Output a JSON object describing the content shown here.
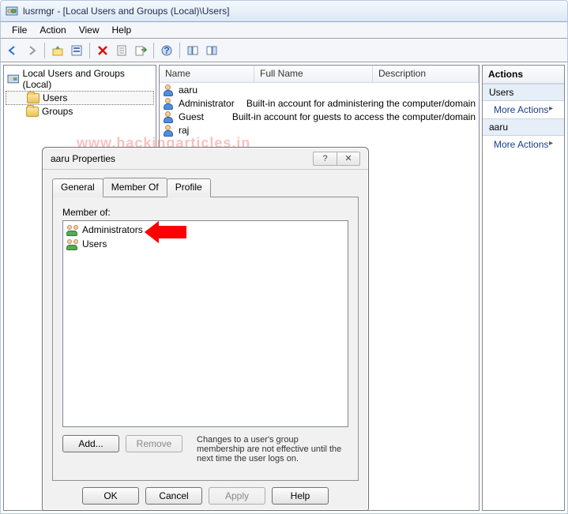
{
  "window": {
    "title": "lusrmgr - [Local Users and Groups (Local)\\Users]"
  },
  "menu": {
    "file": "File",
    "action": "Action",
    "view": "View",
    "help": "Help"
  },
  "tree": {
    "root": "Local Users and Groups (Local)",
    "users": "Users",
    "groups": "Groups"
  },
  "list": {
    "headers": {
      "name": "Name",
      "fullname": "Full Name",
      "description": "Description"
    },
    "rows": [
      {
        "name": "aaru",
        "fullname": "",
        "description": ""
      },
      {
        "name": "Administrator",
        "fullname": "",
        "description": "Built-in account for administering the computer/domain"
      },
      {
        "name": "Guest",
        "fullname": "",
        "description": "Built-in account for guests to access the computer/domain"
      },
      {
        "name": "raj",
        "fullname": "",
        "description": ""
      }
    ]
  },
  "actions": {
    "title": "Actions",
    "group1": "Users",
    "more1": "More Actions",
    "group2": "aaru",
    "more2": "More Actions"
  },
  "dialog": {
    "title": "aaru Properties",
    "tabs": {
      "general": "General",
      "memberof": "Member Of",
      "profile": "Profile"
    },
    "memberof_label": "Member of:",
    "members": [
      "Administrators",
      "Users"
    ],
    "add": "Add...",
    "remove": "Remove",
    "note": "Changes to a user's group membership are not effective until the next time the user logs on.",
    "ok": "OK",
    "cancel": "Cancel",
    "apply": "Apply",
    "help": "Help"
  },
  "watermark": "www.hackingarticles.in"
}
